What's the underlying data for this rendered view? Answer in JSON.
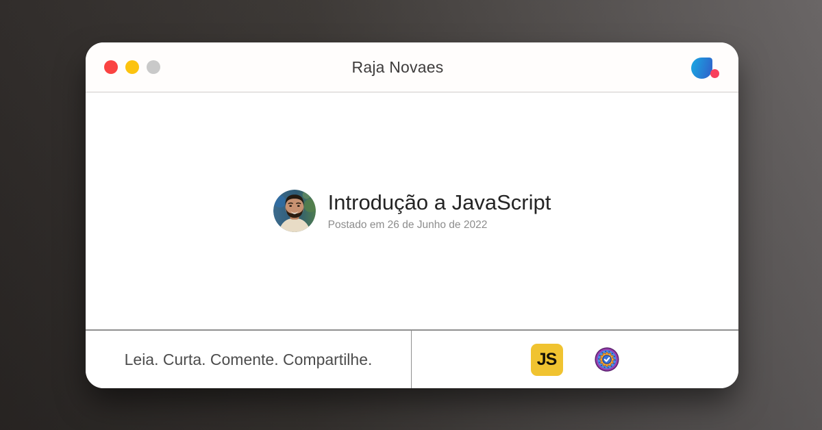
{
  "window": {
    "title": "Raja Novaes",
    "traffic_lights": [
      {
        "name": "close",
        "color": "#fa4342"
      },
      {
        "name": "minimize",
        "color": "#fcc30f"
      },
      {
        "name": "inactive",
        "color": "#c9c9c9"
      }
    ],
    "brand_icon": "dio-logo"
  },
  "post": {
    "title": "Introdução a JavaScript",
    "date": "Postado em 26 de Junho de 2022",
    "avatar": "author-photo"
  },
  "footer": {
    "tagline": "Leia. Curta. Comente. Compartilhe.",
    "js_label": "JS",
    "badges": [
      "javascript-logo",
      "achievement-medal-badge"
    ]
  },
  "colors": {
    "background_dark": "#2d2927",
    "background_light": "#676363",
    "card_white": "#ffffff",
    "traffic_red": "#fa4342",
    "traffic_yellow": "#fcc30f",
    "traffic_gray": "#c9c9c9",
    "dio_blue_light": "#1ba2e0",
    "dio_blue_dark": "#2e66cc",
    "dio_dot_red": "#f8405c",
    "js_yellow": "#f0c330",
    "divider_gray": "#8e8e8e",
    "title_text": "#3e3c3c",
    "post_title_text": "#242424",
    "date_text": "#8c8c8c",
    "tagline_text": "#4c4c4c"
  }
}
